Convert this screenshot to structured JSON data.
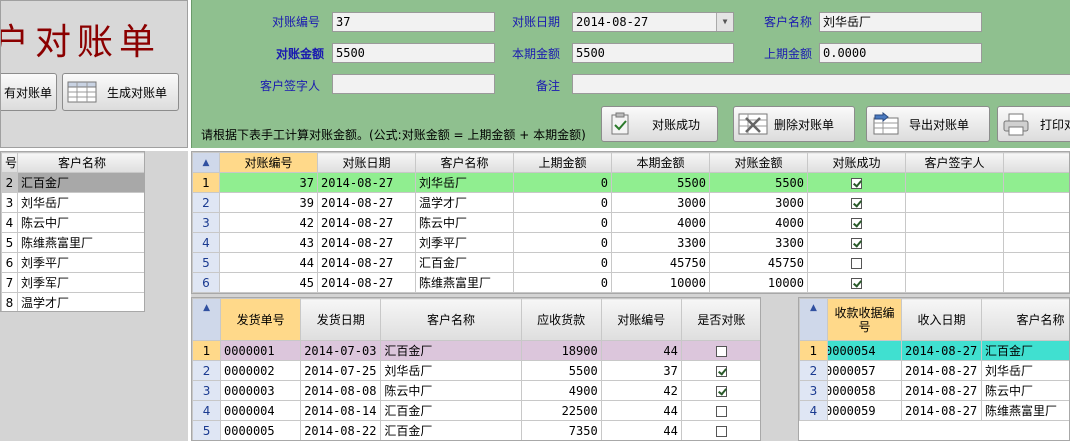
{
  "title_panel": {
    "title": "户对账单",
    "left_button": "有对账单",
    "generate_button": "生成对账单"
  },
  "form": {
    "recon_no_label": "对账编号",
    "recon_no_value": "37",
    "recon_date_label": "对账日期",
    "recon_date_value": "2014-08-27",
    "customer_label": "客户名称",
    "customer_value": "刘华岳厂",
    "recon_amount_label": "对账金额",
    "recon_amount_value": "5500",
    "current_amount_label": "本期金额",
    "current_amount_value": "5500",
    "prev_amount_label": "上期金额",
    "prev_amount_value": "0.0000",
    "signer_label": "客户签字人",
    "signer_value": "",
    "remark_label": "备注",
    "remark_value": "",
    "instruction": "请根据下表手工计算对账金额。(公式:对账金额 = 上期金额 + 本期金额)"
  },
  "actions": {
    "success": "对账成功",
    "delete": "删除对账单",
    "export": "导出对账单",
    "print": "打印对"
  },
  "customer_list": {
    "headers": [
      "号",
      "客户名称"
    ],
    "rows": [
      {
        "no": "2",
        "name": "汇百金厂",
        "selected": true
      },
      {
        "no": "3",
        "name": "刘华岳厂",
        "selected": false
      },
      {
        "no": "4",
        "name": "陈云中厂",
        "selected": false
      },
      {
        "no": "5",
        "name": "陈维燕富里厂",
        "selected": false
      },
      {
        "no": "6",
        "name": "刘季平厂",
        "selected": false
      },
      {
        "no": "7",
        "name": "刘季军厂",
        "selected": false
      },
      {
        "no": "8",
        "name": "温学才厂",
        "selected": false
      }
    ]
  },
  "recon_table": {
    "headers": [
      "对账编号",
      "对账日期",
      "客户名称",
      "上期金额",
      "本期金额",
      "对账金额",
      "对账成功",
      "客户签字人"
    ],
    "rows": [
      {
        "rn": "1",
        "no": "37",
        "date": "2014-08-27",
        "customer": "刘华岳厂",
        "prev": "0",
        "current": "5500",
        "total": "5500",
        "success": true,
        "signer": ""
      },
      {
        "rn": "2",
        "no": "39",
        "date": "2014-08-27",
        "customer": "温学才厂",
        "prev": "0",
        "current": "3000",
        "total": "3000",
        "success": true,
        "signer": ""
      },
      {
        "rn": "3",
        "no": "42",
        "date": "2014-08-27",
        "customer": "陈云中厂",
        "prev": "0",
        "current": "4000",
        "total": "4000",
        "success": true,
        "signer": ""
      },
      {
        "rn": "4",
        "no": "43",
        "date": "2014-08-27",
        "customer": "刘季平厂",
        "prev": "0",
        "current": "3300",
        "total": "3300",
        "success": true,
        "signer": ""
      },
      {
        "rn": "5",
        "no": "44",
        "date": "2014-08-27",
        "customer": "汇百金厂",
        "prev": "0",
        "current": "45750",
        "total": "45750",
        "success": false,
        "signer": ""
      },
      {
        "rn": "6",
        "no": "45",
        "date": "2014-08-27",
        "customer": "陈维燕富里厂",
        "prev": "0",
        "current": "10000",
        "total": "10000",
        "success": true,
        "signer": ""
      }
    ]
  },
  "shipment_table": {
    "headers": [
      "发货单号",
      "发货日期",
      "客户名称",
      "应收货款",
      "对账编号",
      "是否对账"
    ],
    "rows": [
      {
        "rn": "1",
        "no": "0000001",
        "date": "2014-07-03",
        "customer": "汇百金厂",
        "amount": "18900",
        "recon_no": "44",
        "checked": false
      },
      {
        "rn": "2",
        "no": "0000002",
        "date": "2014-07-25",
        "customer": "刘华岳厂",
        "amount": "5500",
        "recon_no": "37",
        "checked": true
      },
      {
        "rn": "3",
        "no": "0000003",
        "date": "2014-08-08",
        "customer": "陈云中厂",
        "amount": "4900",
        "recon_no": "42",
        "checked": true
      },
      {
        "rn": "4",
        "no": "0000004",
        "date": "2014-08-14",
        "customer": "汇百金厂",
        "amount": "22500",
        "recon_no": "44",
        "checked": false
      },
      {
        "rn": "5",
        "no": "0000005",
        "date": "2014-08-22",
        "customer": "汇百金厂",
        "amount": "7350",
        "recon_no": "44",
        "checked": false
      }
    ]
  },
  "receipt_table": {
    "headers": [
      "收款收据编号",
      "收入日期",
      "客户名称"
    ],
    "rows": [
      {
        "rn": "1",
        "no": "0000054",
        "date": "2014-08-27",
        "customer": "汇百金厂"
      },
      {
        "rn": "2",
        "no": "0000057",
        "date": "2014-08-27",
        "customer": "刘华岳厂"
      },
      {
        "rn": "3",
        "no": "0000058",
        "date": "2014-08-27",
        "customer": "陈云中厂"
      },
      {
        "rn": "4",
        "no": "0000059",
        "date": "2014-08-27",
        "customer": "陈维燕富里厂"
      }
    ]
  },
  "colors": {
    "form_bg": "#8fc08f",
    "title_red": "#8b0000",
    "row_highlight_green": "#90ee90",
    "row_highlight_pink": "#dcc6dc",
    "row_highlight_cyan": "#40e0d0",
    "label_blue": "#1a1ab0"
  }
}
